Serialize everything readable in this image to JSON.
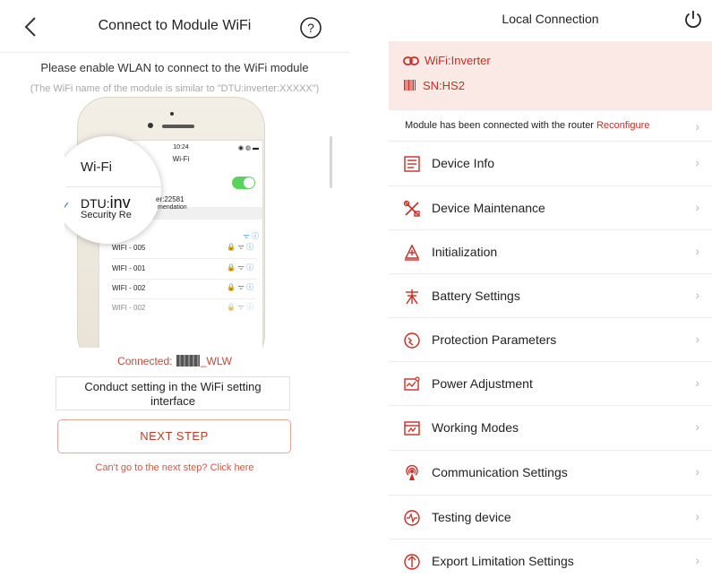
{
  "left_screen": {
    "title": "Connect to Module WiFi",
    "instruction": "Please enable WLAN to connect to the WiFi module",
    "hint": "(The WiFi name of the module is similar to \"DTU:inverter:XXXXX\")",
    "illustration": {
      "status_time": "10:24",
      "status_left": "•••○○",
      "status_right": "◉ ◍ ▬",
      "screen_title": "Wi-Fi",
      "wifi_label": "Wi-Fi",
      "dtu_prefix": "DTU:",
      "dtu_big": "inv",
      "dtu_tail": "er:22581",
      "security_text": "Security Re",
      "security_tail": "mendation",
      "connected_icons": "ᯤ ⓘ",
      "networks": [
        {
          "name": "WIFI - 005",
          "icons": "🔒 ᯤ",
          "info": "ⓘ"
        },
        {
          "name": "WIFI - 001",
          "icons": "🔒 ᯤ",
          "info": "ⓘ"
        },
        {
          "name": "WIFI - 002",
          "icons": "🔒 ᯤ",
          "info": "ⓘ"
        },
        {
          "name": "WIFI - 002",
          "icons": "🔒 ᯤ",
          "info": "ⓘ"
        }
      ]
    },
    "connected_prefix": "Connected:",
    "connected_suffix": "_WLW",
    "conduct_line1": "Conduct setting in the WiFi setting",
    "conduct_line2": "interface",
    "next_button": "NEXT STEP",
    "cant_go_link": "Can't go to the next step? Click here"
  },
  "right_screen": {
    "title": "Local Connection",
    "wifi_info": "WiFi:Inverter",
    "sn_info": "SN:HS2",
    "module_status": "Module has been connected with the router",
    "reconfigure": "Reconfigure",
    "chevron": "›",
    "menu": [
      {
        "label": "Device Info",
        "icon": "device-info-icon"
      },
      {
        "label": "Device Maintenance",
        "icon": "tools-icon"
      },
      {
        "label": "Initialization",
        "icon": "initialization-icon"
      },
      {
        "label": "Battery Settings",
        "icon": "battery-tower-icon"
      },
      {
        "label": "Protection Parameters",
        "icon": "protection-icon"
      },
      {
        "label": "Power Adjustment",
        "icon": "power-adjustment-icon"
      },
      {
        "label": "Working Modes",
        "icon": "working-modes-icon"
      },
      {
        "label": "Communication Settings",
        "icon": "antenna-icon"
      },
      {
        "label": "Testing device",
        "icon": "testing-icon"
      },
      {
        "label": "Export Limitation Settings",
        "icon": "export-limit-icon"
      }
    ]
  },
  "colors": {
    "accent_red": "#cc2c23",
    "banner_bg": "#fae9e5",
    "link_red": "#d05a45",
    "toggle_green": "#5ad35a",
    "ios_blue": "#2e7de0"
  }
}
